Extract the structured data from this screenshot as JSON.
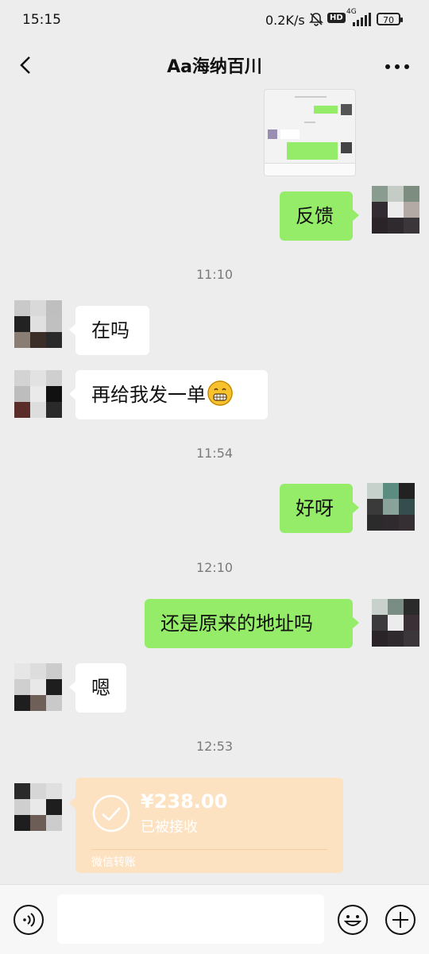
{
  "status_bar": {
    "time": "15:15",
    "network_speed": "0.2K/s",
    "hd_badge": "HD",
    "signal_label": "4G",
    "battery": "70"
  },
  "header": {
    "title": "Aa海纳百川",
    "back_icon": "chevron-left-icon",
    "more_icon": "more-horizontal-icon"
  },
  "messages": {
    "msg1": "反馈",
    "ts1": "11:10",
    "msg2": "在吗",
    "msg3": "再给我发一单",
    "ts2": "11:54",
    "msg4": "好呀",
    "ts3": "12:10",
    "msg5": "还是原来的地址吗",
    "msg6": "嗯",
    "ts4": "12:53"
  },
  "transfer": {
    "amount": "¥238.00",
    "status": "已被接收",
    "label": "微信转账"
  },
  "input_bar": {
    "voice_icon": "voice-icon",
    "emoji_icon": "emoji-icon",
    "plus_icon": "plus-icon"
  },
  "colors": {
    "background": "#ededed",
    "outgoing_bubble": "#95ec69",
    "incoming_bubble": "#ffffff",
    "transfer_card": "#fde2c2"
  }
}
